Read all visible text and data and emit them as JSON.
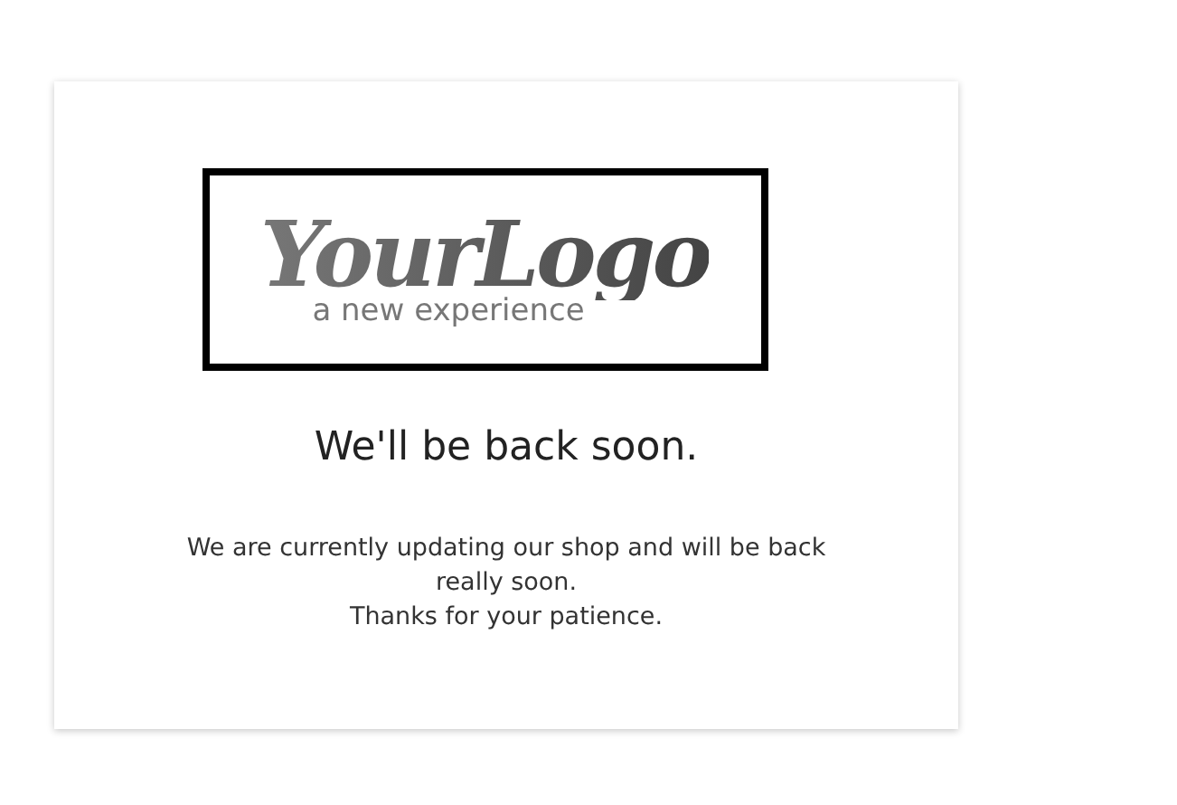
{
  "logo": {
    "name": "YourLogo",
    "tagline": "a new experience"
  },
  "heading": "We'll be back soon.",
  "message": [
    "We are currently updating our shop and will be back really soon.",
    "Thanks for your patience."
  ]
}
